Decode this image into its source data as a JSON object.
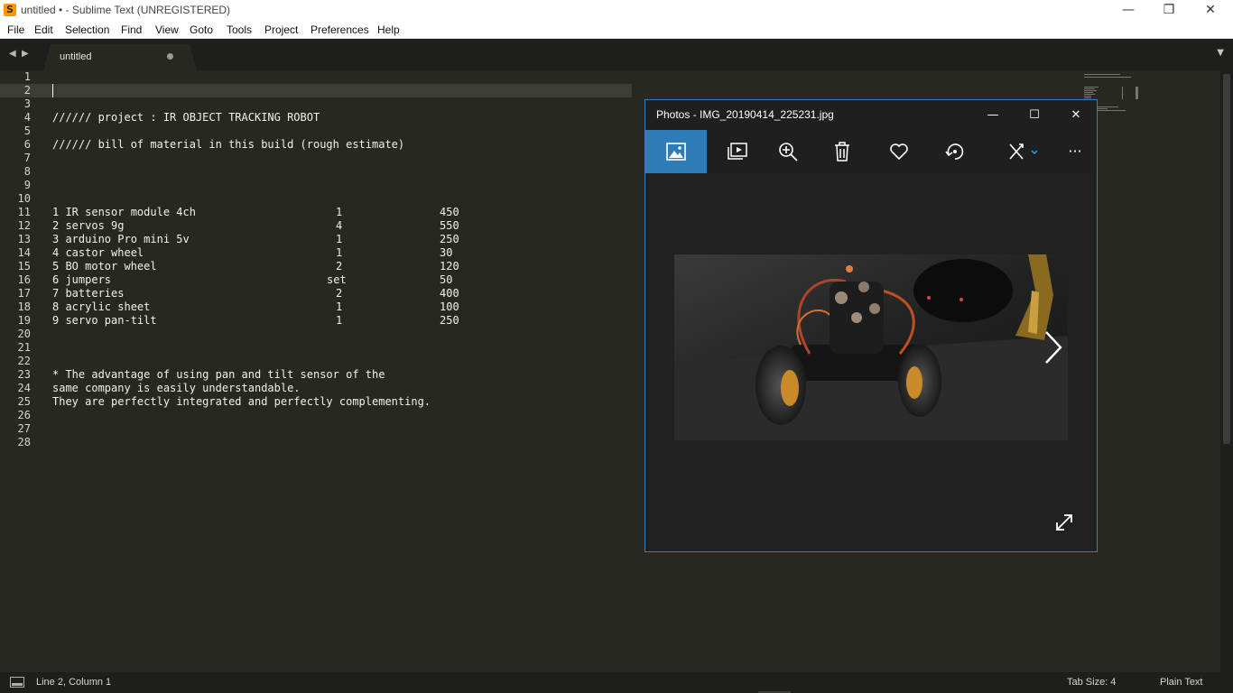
{
  "window": {
    "title": "untitled • - Sublime Text (UNREGISTERED)",
    "app_icon_glyph": "S",
    "minimize": "—",
    "restore": "❐",
    "close": "✕"
  },
  "menu": [
    "File",
    "Edit",
    "Selection",
    "Find",
    "View",
    "Goto",
    "Tools",
    "Project",
    "Preferences",
    "Help"
  ],
  "tabs": {
    "active": "untitled",
    "back_arrow": "◀",
    "forward_arrow": "▶",
    "dropdown": "▼"
  },
  "editor": {
    "line_numbers": [
      "1",
      "2",
      "3",
      "4",
      "5",
      "6",
      "7",
      "8",
      "9",
      "10",
      "11",
      "12",
      "13",
      "14",
      "15",
      "16",
      "17",
      "18",
      "19",
      "20",
      "21",
      "22",
      "23",
      "24",
      "25",
      "26",
      "27",
      "28"
    ],
    "lines": [
      "",
      "",
      "",
      "////// project : IR OBJECT TRACKING ROBOT",
      "",
      "////// bill of material in this build (rough estimate)",
      "",
      "",
      "",
      "",
      "",
      "",
      "",
      "",
      "",
      "",
      "",
      "",
      "",
      "",
      "",
      "",
      "* The advantage of using pan and tilt sensor of the",
      "same company is easily understandable.",
      "They are perfectly integrated and perfectly complementing.",
      "",
      "",
      ""
    ],
    "bom": [
      {
        "item": "1 IR sensor module 4ch",
        "qty": "1",
        "price": "450"
      },
      {
        "item": "2 servos 9g",
        "qty": "4",
        "price": "550"
      },
      {
        "item": "3 arduino Pro mini 5v",
        "qty": "1",
        "price": "250"
      },
      {
        "item": "4 castor wheel",
        "qty": "1",
        "price": "30"
      },
      {
        "item": "5 BO motor wheel",
        "qty": "2",
        "price": "120"
      },
      {
        "item": "6 jumpers",
        "qty": "set",
        "price": "50"
      },
      {
        "item": "7 batteries",
        "qty": "2",
        "price": "400"
      },
      {
        "item": "8 acrylic sheet",
        "qty": "1",
        "price": "100"
      },
      {
        "item": "9 servo pan-tilt",
        "qty": "1",
        "price": "250"
      }
    ]
  },
  "status": {
    "position": "Line 2, Column 1",
    "tab_size": "Tab Size: 4",
    "syntax": "Plain Text"
  },
  "photos": {
    "title": "Photos - IMG_20190414_225231.jpg",
    "minimize": "—",
    "maximize": "☐",
    "close": "✕",
    "more": "···",
    "toolbar_icons": [
      "view-image-icon",
      "slideshow-icon",
      "zoom-icon",
      "delete-icon",
      "favorite-icon",
      "rotate-icon",
      "edit-draw-icon",
      "more-icon"
    ]
  },
  "colors": {
    "editor_bg": "#272822",
    "gutter_bg": "#1e1f1c",
    "accent": "#2d7bb7",
    "photos_bg": "#212121"
  }
}
